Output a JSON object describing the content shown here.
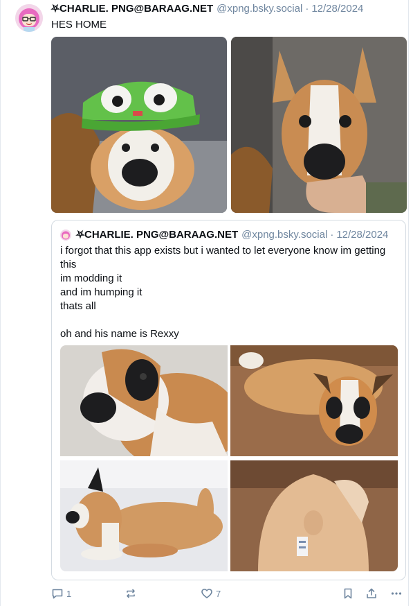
{
  "post": {
    "author": "⛧CHARLIE. PNG@BARAAG.NET",
    "handle": "@xpng.bsky.social",
    "separator": "·",
    "date": "12/28/2024",
    "text": "HES HOME",
    "images": [
      {
        "subject": "dog plush wearing green alien cap"
      },
      {
        "subject": "dog plush held in hand"
      }
    ]
  },
  "quote": {
    "author": "⛧CHARLIE. PNG@BARAAG.NET",
    "handle": "@xpng.bsky.social",
    "separator": "·",
    "date": "12/28/2024",
    "text": "i forgot that this app exists but i wanted to let everyone know im getting this\nim modding it\nand im humping it\nthats all\n\noh and his name is Rexxy",
    "images": [
      {
        "subject": "boxer plush close-up"
      },
      {
        "subject": "boxer plush on couch"
      },
      {
        "subject": "boxer plush side view"
      },
      {
        "subject": "boxer plush rear view"
      }
    ]
  },
  "actions": {
    "reply_count": "1",
    "repost_count": "",
    "like_count": "7"
  },
  "icons": [
    "reply-icon",
    "repost-icon",
    "like-icon",
    "bookmark-icon",
    "share-icon",
    "more-icon"
  ],
  "colors": {
    "muted": "#6f869f",
    "border": "#d4dbe2",
    "text": "#0b0f14"
  }
}
